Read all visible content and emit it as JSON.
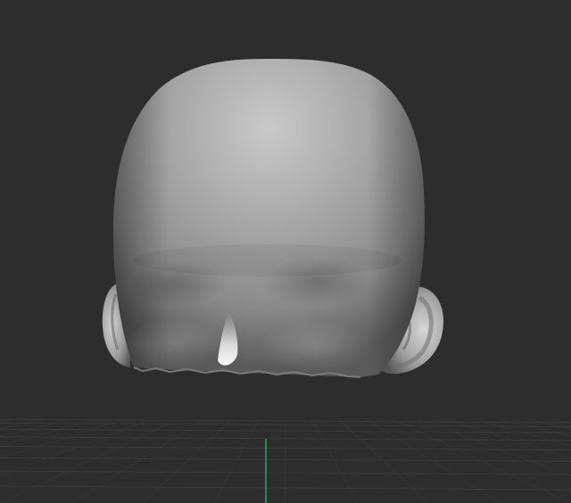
{
  "viewport": {
    "background": "#2d2d2d",
    "grid_color": "#3b3b3b",
    "axis_color": "#2aa852"
  },
  "model": {
    "material_base": "#9c9c9c",
    "material_highlight": "#d4d4d4",
    "material_shadow": "#4a4a4a"
  }
}
